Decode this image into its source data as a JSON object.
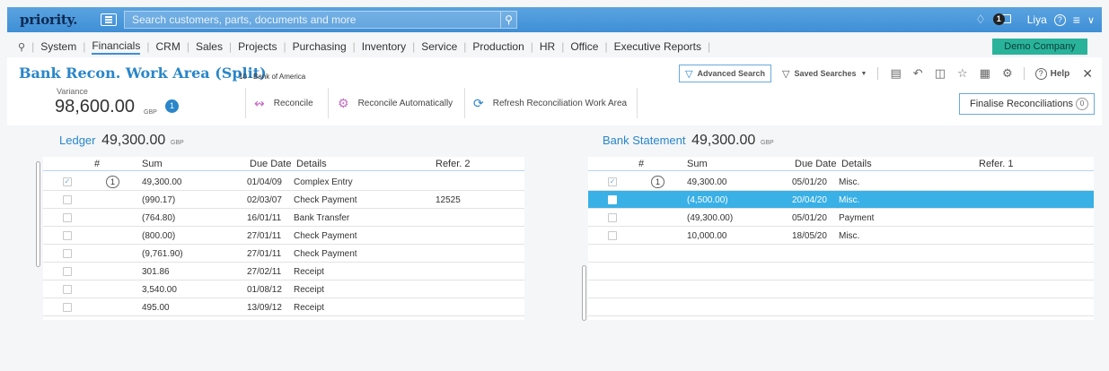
{
  "topbar": {
    "logo": "priority.",
    "search_placeholder": "Search customers, parts, documents and more",
    "notifications_count": "1",
    "user_name": "Liya"
  },
  "menu": {
    "items": [
      "System",
      "Financials",
      "CRM",
      "Sales",
      "Projects",
      "Purchasing",
      "Inventory",
      "Service",
      "Production",
      "HR",
      "Office",
      "Executive Reports"
    ],
    "active": "Financials",
    "company": "Demo Company"
  },
  "form": {
    "title": "Bank Recon. Work Area (Split)",
    "subtitle": "10 - Bank of America",
    "variance_label": "Variance",
    "variance_value": "98,600.00",
    "variance_unit": "GBP",
    "variance_badge": "1",
    "actions": {
      "reconcile": "Reconcile",
      "reconcile_auto": "Reconcile Automatically",
      "refresh": "Refresh Reconciliation Work Area"
    },
    "toolbar": {
      "advanced_search": "Advanced Search",
      "saved_searches": "Saved Searches",
      "help": "Help"
    },
    "finalise_label": "Finalise Reconciliations",
    "finalise_count": "0"
  },
  "ledger": {
    "title": "Ledger",
    "amount": "49,300.00",
    "unit": "GBP",
    "columns": [
      "#",
      "Sum",
      "Due Date",
      "Details",
      "Refer. 2"
    ],
    "rows": [
      {
        "checked": true,
        "num": "1",
        "sum": "49,300.00",
        "date": "01/04/09",
        "details": "Complex Entry",
        "ref": ""
      },
      {
        "checked": false,
        "num": "",
        "sum": "(990.17)",
        "date": "02/03/07",
        "details": "Check Payment",
        "ref": "12525"
      },
      {
        "checked": false,
        "num": "",
        "sum": "(764.80)",
        "date": "16/01/11",
        "details": "Bank Transfer",
        "ref": ""
      },
      {
        "checked": false,
        "num": "",
        "sum": "(800.00)",
        "date": "27/01/11",
        "details": "Check Payment",
        "ref": ""
      },
      {
        "checked": false,
        "num": "",
        "sum": "(9,761.90)",
        "date": "27/01/11",
        "details": "Check Payment",
        "ref": ""
      },
      {
        "checked": false,
        "num": "",
        "sum": "301.86",
        "date": "27/02/11",
        "details": "Receipt",
        "ref": ""
      },
      {
        "checked": false,
        "num": "",
        "sum": "3,540.00",
        "date": "01/08/12",
        "details": "Receipt",
        "ref": ""
      },
      {
        "checked": false,
        "num": "",
        "sum": "495.00",
        "date": "13/09/12",
        "details": "Receipt",
        "ref": ""
      }
    ]
  },
  "bank": {
    "title": "Bank Statement",
    "amount": "49,300.00",
    "unit": "GBP",
    "columns": [
      "#",
      "Sum",
      "Due Date",
      "Details",
      "Refer. 1"
    ],
    "rows": [
      {
        "checked": true,
        "num": "1",
        "sum": "49,300.00",
        "date": "05/01/20",
        "details": "Misc.",
        "ref": "",
        "selected": false
      },
      {
        "checked": false,
        "num": "",
        "sum": "(4,500.00)",
        "date": "20/04/20",
        "details": "Misc.",
        "ref": "",
        "selected": true
      },
      {
        "checked": false,
        "num": "",
        "sum": "(49,300.00)",
        "date": "05/01/20",
        "details": "Payment",
        "ref": "",
        "selected": false
      },
      {
        "checked": false,
        "num": "",
        "sum": "10,000.00",
        "date": "18/05/20",
        "details": "Misc.",
        "ref": "",
        "selected": false
      }
    ]
  },
  "colors": {
    "accent": "#2a86c9",
    "topbar": "#4a99dc",
    "selected_row": "#39b0e6",
    "company_badge": "#2ab39b"
  }
}
